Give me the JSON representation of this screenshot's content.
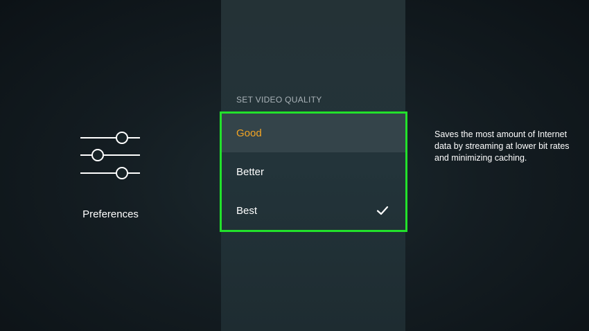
{
  "sidebar": {
    "label": "Preferences",
    "icon": "sliders-icon"
  },
  "video_quality": {
    "title": "SET VIDEO QUALITY",
    "options": [
      {
        "label": "Good",
        "focused": true,
        "selected": false
      },
      {
        "label": "Better",
        "focused": false,
        "selected": false
      },
      {
        "label": "Best",
        "focused": false,
        "selected": true
      }
    ],
    "selected_icon": "check-icon",
    "description": "Saves the most amount of Internet data by streaming at lower bit rates and minimizing caching."
  },
  "colors": {
    "focus_border": "#22e12b",
    "focused_text": "#f5a623",
    "text": "#ffffff"
  }
}
